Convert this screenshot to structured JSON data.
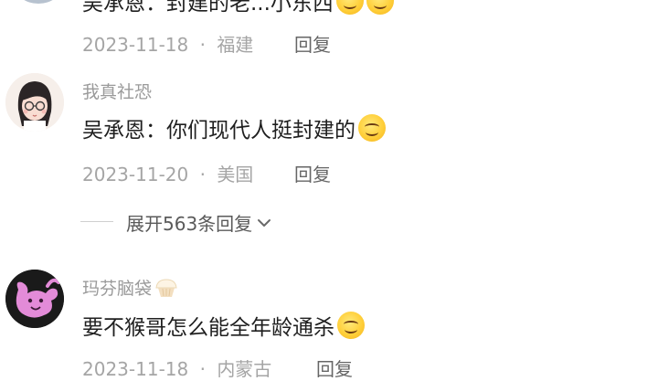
{
  "comment_top": {
    "content": "吴承恩：封建的老...小东西",
    "date": "2023-11-18",
    "separator": "·",
    "location": "福建",
    "reply_label": "回复"
  },
  "comment_1": {
    "username": "我真社恐",
    "content": "吴承恩：你们现代人挺封建的",
    "date": "2023-11-20",
    "separator": "·",
    "location": "美国",
    "reply_label": "回复"
  },
  "expand": {
    "label": "展开563条回复"
  },
  "comment_2": {
    "username": "玛芬脑袋",
    "content": "要不猴哥怎么能全年龄通杀",
    "date": "2023-11-18",
    "separator": "·",
    "location": "内蒙古",
    "reply_label": "回复"
  },
  "colors": {
    "meta_text": "#a5a5a5",
    "avatar_pink_bg": "#1a1a1a",
    "avatar_pink_fg": "#e38bd8"
  },
  "icons": {
    "smile": "smile-emoji-icon",
    "chevron": "chevron-down-icon",
    "muffin": "muffin-emoji-icon"
  }
}
